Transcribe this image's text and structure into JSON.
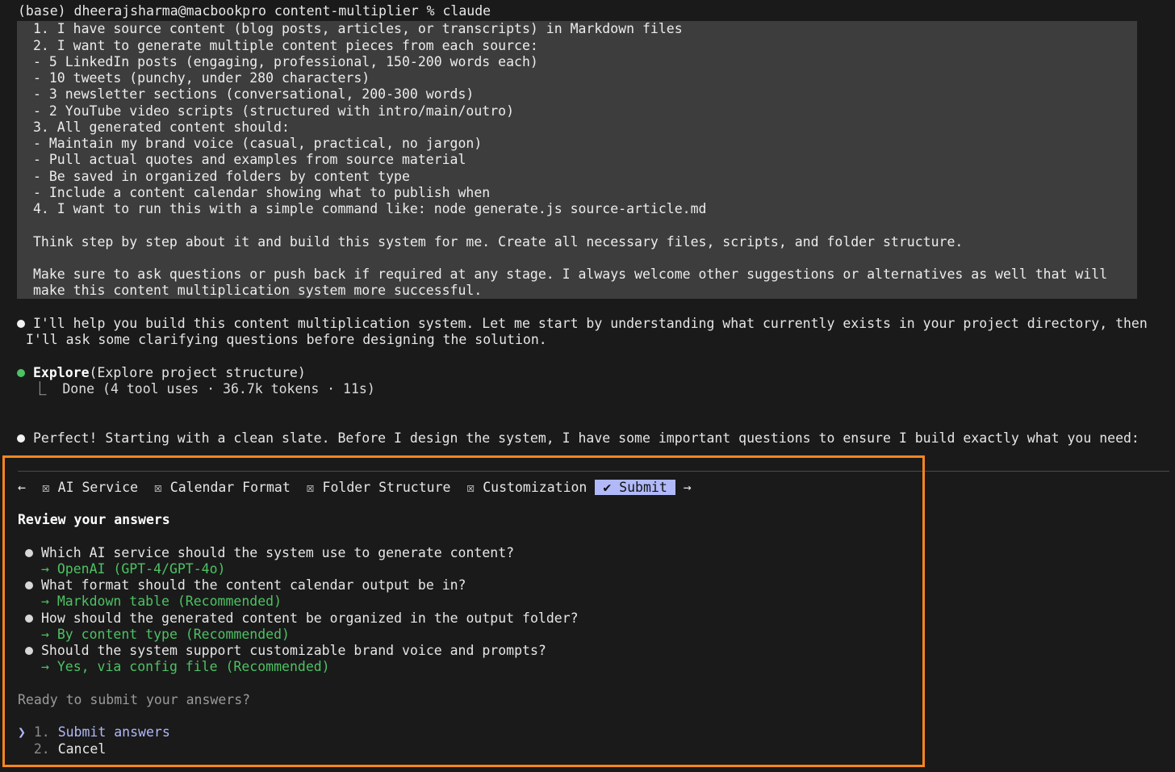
{
  "terminal": {
    "prompt": "(base) dheerajsharma@macbookpro content-multiplier % claude"
  },
  "user_message": {
    "lines": [
      "1. I have source content (blog posts, articles, or transcripts) in Markdown files",
      "2. I want to generate multiple content pieces from each source:",
      "- 5 LinkedIn posts (engaging, professional, 150-200 words each)",
      "- 10 tweets (punchy, under 280 characters)",
      "- 3 newsletter sections (conversational, 200-300 words)",
      "- 2 YouTube video scripts (structured with intro/main/outro)",
      "3. All generated content should:",
      "- Maintain my brand voice (casual, practical, no jargon)",
      "- Pull actual quotes and examples from source material",
      "- Be saved in organized folders by content type",
      "- Include a content calendar showing what to publish when",
      "4. I want to run this with a simple command like: node generate.js source-article.md",
      "",
      "Think step by step about it and build this system for me. Create all necessary files, scripts, and folder structure.",
      "",
      "Make sure to ask questions or push back if required at any stage. I always welcome other suggestions or alternatives as well that will",
      "make this content multiplication system more successful."
    ]
  },
  "assistant": {
    "intro_line1": "I'll help you build this content multiplication system. Let me start by understanding what currently exists in your project directory, then",
    "intro_line2": "I'll ask some clarifying questions before designing the solution.",
    "tool_name": "Explore",
    "tool_args": "(Explore project structure)",
    "tool_result": "⎿  Done (4 tool uses · 36.7k tokens · 11s)",
    "followup": "Perfect! Starting with a clean slate. Before I design the system, I have some important questions to ensure I build exactly what you need:"
  },
  "question_panel": {
    "nav_left": "←",
    "nav_right": "→",
    "tabs": [
      {
        "label": "☒ AI Service"
      },
      {
        "label": "☒ Calendar Format"
      },
      {
        "label": "☒ Folder Structure"
      },
      {
        "label": "☒ Customization"
      }
    ],
    "active_tab": "✔ Submit",
    "review_title": "Review your answers",
    "answers": [
      {
        "question": "Which AI service should the system use to generate content?",
        "answer": "→ OpenAI (GPT-4/GPT-4o)"
      },
      {
        "question": "What format should the content calendar output be in?",
        "answer": "→ Markdown table (Recommended)"
      },
      {
        "question": "How should the generated content be organized in the output folder?",
        "answer": "→ By content type (Recommended)"
      },
      {
        "question": "Should the system support customizable brand voice and prompts?",
        "answer": "→ Yes, via config file (Recommended)"
      }
    ],
    "ready_prompt": "Ready to submit your answers?",
    "options": [
      {
        "pointer": "❯",
        "number": "1.",
        "label": "Submit answers"
      },
      {
        "pointer": " ",
        "number": "2.",
        "label": "Cancel"
      }
    ],
    "highlight_color": "#f5861f",
    "active_tab_color": "#b1b9f9",
    "answer_color": "#4cc263"
  }
}
